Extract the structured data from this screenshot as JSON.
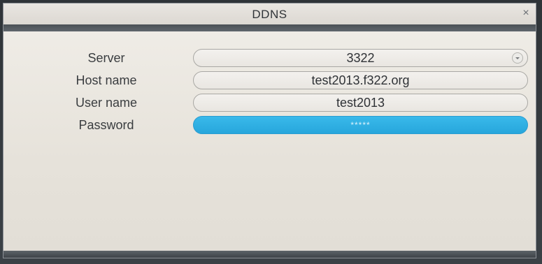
{
  "window": {
    "title": "DDNS",
    "close_glyph": "×"
  },
  "form": {
    "server": {
      "label": "Server",
      "value": "3322"
    },
    "host_name": {
      "label": "Host name",
      "value": "test2013.f322.org"
    },
    "user_name": {
      "label": "User name",
      "value": "test2013"
    },
    "password": {
      "label": "Password",
      "value": "*****"
    }
  },
  "colors": {
    "selected_field": "#2eaee3",
    "dialog_background": "#e7e3dc"
  },
  "icons": {
    "close": "close-icon",
    "dropdown": "chevron-down-icon"
  }
}
